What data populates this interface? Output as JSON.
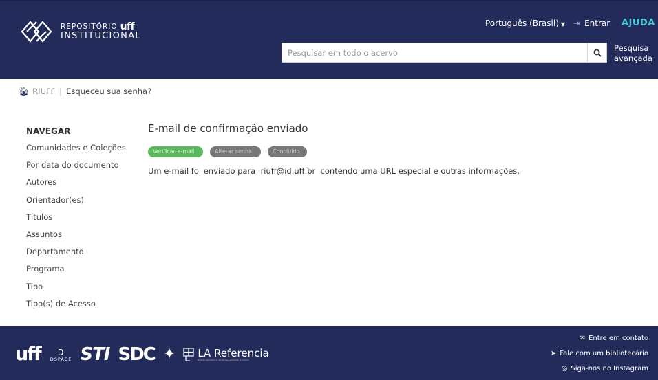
{
  "header": {
    "logo": {
      "line1": "REPOSITÓRIO",
      "brand": "uff",
      "line2": "INSTITUCIONAL"
    },
    "language": "Português (Brasil)",
    "login": "Entrar",
    "help": "AJUDA",
    "search": {
      "placeholder": "Pesquisar em todo o acervo",
      "advanced_line1": "Pesquisa",
      "advanced_line2": "avançada"
    }
  },
  "breadcrumb": {
    "root": "RIUFF",
    "separator": "|",
    "current": "Esqueceu sua senha?"
  },
  "sidebar": {
    "title": "NAVEGAR",
    "items": [
      {
        "label": "Comunidades e Coleções"
      },
      {
        "label": "Por data do documento"
      },
      {
        "label": "Autores"
      },
      {
        "label": "Orientador(es)"
      },
      {
        "label": "Títulos"
      },
      {
        "label": "Assuntos"
      },
      {
        "label": "Departamento"
      },
      {
        "label": "Programa"
      },
      {
        "label": "Tipo"
      },
      {
        "label": "Tipo(s) de Acesso"
      }
    ]
  },
  "main": {
    "title": "E-mail de confirmação enviado",
    "steps": [
      {
        "label": "Verificar e-mail",
        "state": "active"
      },
      {
        "label": "Alterar senha",
        "state": "inactive"
      },
      {
        "label": "Concluído",
        "state": "inactive"
      }
    ],
    "message": "Um e-mail foi enviado para  riuff@id.uff.br  contendo uma URL especial e outras informações."
  },
  "footer": {
    "logos": {
      "uff": "uff",
      "dspace": "DSPACE",
      "sti": "STI",
      "sdc": "SDC",
      "lareferencia": "LA Referencia",
      "lareferencia_sub": "Red de repositorios de acceso abierto a la ciencia"
    },
    "links": [
      {
        "label": "Entre em contato",
        "icon": "envelope-icon"
      },
      {
        "label": "Fale com um bibliotecário",
        "icon": "send-icon"
      },
      {
        "label": "Siga-nos no Instagram",
        "icon": "instagram-icon"
      }
    ]
  },
  "colors": {
    "header_bg": "#222b5a",
    "help_accent": "#46c8d9",
    "step_active": "#5cb85c",
    "step_inactive": "#777777"
  }
}
